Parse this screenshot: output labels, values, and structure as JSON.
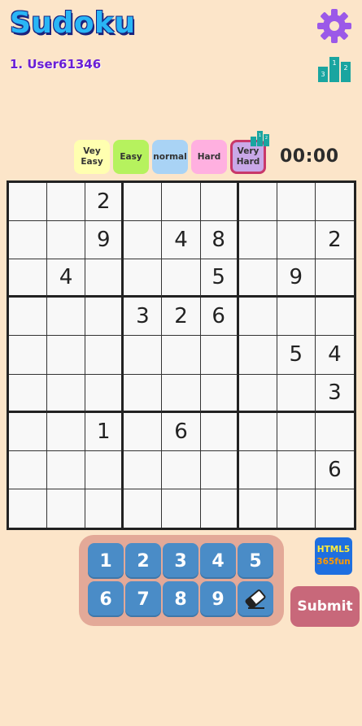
{
  "header": {
    "title": "Sudoku",
    "user_label": "1. User61346"
  },
  "difficulty": [
    {
      "label": "Vey\nEasy",
      "color": "#ffffb0",
      "selected": false
    },
    {
      "label": "Easy",
      "color": "#b6f25e",
      "selected": false
    },
    {
      "label": "normal",
      "color": "#a9d3f5",
      "selected": false
    },
    {
      "label": "Hard",
      "color": "#ffb0e0",
      "selected": false
    },
    {
      "label": "Very\nHard",
      "color": "#c9a8e8",
      "selected": true,
      "border_color": "#c8386a"
    }
  ],
  "timer": "00:00",
  "mini_podium_labels": [
    "1",
    "2"
  ],
  "podium_labels": [
    "3",
    "1",
    "2"
  ],
  "board": [
    [
      "",
      "",
      "2",
      "",
      "",
      "",
      "",
      "",
      ""
    ],
    [
      "",
      "",
      "9",
      "",
      "4",
      "8",
      "",
      "",
      "2"
    ],
    [
      "",
      "4",
      "",
      "",
      "",
      "5",
      "",
      "9",
      ""
    ],
    [
      "",
      "",
      "",
      "3",
      "2",
      "6",
      "",
      "",
      ""
    ],
    [
      "",
      "",
      "",
      "",
      "",
      "",
      "",
      "5",
      "4"
    ],
    [
      "",
      "",
      "",
      "",
      "",
      "",
      "",
      "",
      "3"
    ],
    [
      "",
      "",
      "1",
      "",
      "6",
      "",
      "",
      "",
      ""
    ],
    [
      "",
      "",
      "",
      "",
      "",
      "",
      "",
      "",
      "6"
    ],
    [
      "",
      "",
      "",
      "",
      "",
      "",
      "",
      "",
      ""
    ]
  ],
  "keypad": {
    "keys": [
      "1",
      "2",
      "3",
      "4",
      "5",
      "6",
      "7",
      "8",
      "9"
    ],
    "eraser_icon": "eraser-icon"
  },
  "badge": {
    "line1": "HTML5",
    "line2": "365fun"
  },
  "submit_label": "Submit",
  "colors": {
    "background": "#fce5c9",
    "title": "#29b6f6",
    "user": "#6a1fd6",
    "gear": "#9b59e8",
    "podium": "#1aa5a0",
    "key": "#4a8cc7",
    "keypad_bg": "#e3a998",
    "submit": "#c8687a"
  }
}
